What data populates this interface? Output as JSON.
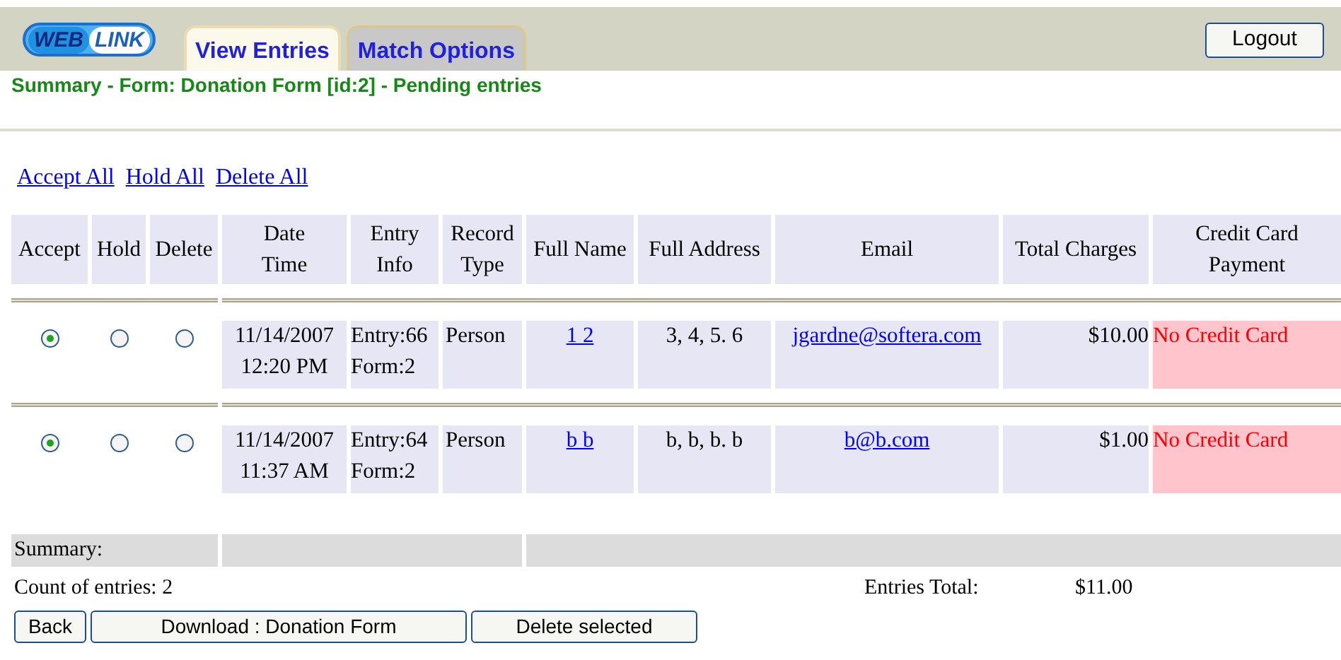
{
  "logo": {
    "parts": [
      "WEB",
      "LINK"
    ]
  },
  "tabs": [
    {
      "label": "View Entries",
      "selected": true
    },
    {
      "label": "Match Options",
      "selected": false
    }
  ],
  "logout_button": "Logout",
  "summary_title": "Summary - Form: Donation Form [id:2] - Pending entries",
  "bulk_links": [
    "Accept All",
    "Hold All",
    "Delete All"
  ],
  "table": {
    "columns": [
      "Accept",
      "Hold",
      "Delete",
      "Date\nTime",
      "Entry\nInfo",
      "Record\nType",
      "Full Name",
      "Full Address",
      "Email",
      "Total Charges",
      "Credit Card\nPayment"
    ],
    "rows": [
      {
        "choices": [
          {
            "selected": true
          },
          {
            "selected": false
          },
          {
            "selected": false
          }
        ],
        "date_time": "11/14/2007\n12:20 PM",
        "entry_info": "Entry:66\nForm:2",
        "record_type": "Person",
        "full_name": "1 2",
        "full_address": "3, 4, 5. 6",
        "email": "jgardne@softera.com",
        "total_charges": "$10.00",
        "payment": "No Credit Card"
      },
      {
        "choices": [
          {
            "selected": true
          },
          {
            "selected": false
          },
          {
            "selected": false
          }
        ],
        "date_time": "11/14/2007\n11:37 AM",
        "entry_info": "Entry:64\nForm:2",
        "record_type": "Person",
        "full_name": "b b",
        "full_address": "b, b, b. b",
        "email": "b@b.com",
        "total_charges": "$1.00",
        "payment": "No Credit Card"
      }
    ]
  },
  "summary": {
    "label": "Summary:",
    "count": "Count of entries: 2",
    "total_label": "Entries Total:",
    "total": "$11.00"
  },
  "buttons": [
    "Back",
    "Download : Donation Form",
    "Delete selected"
  ]
}
